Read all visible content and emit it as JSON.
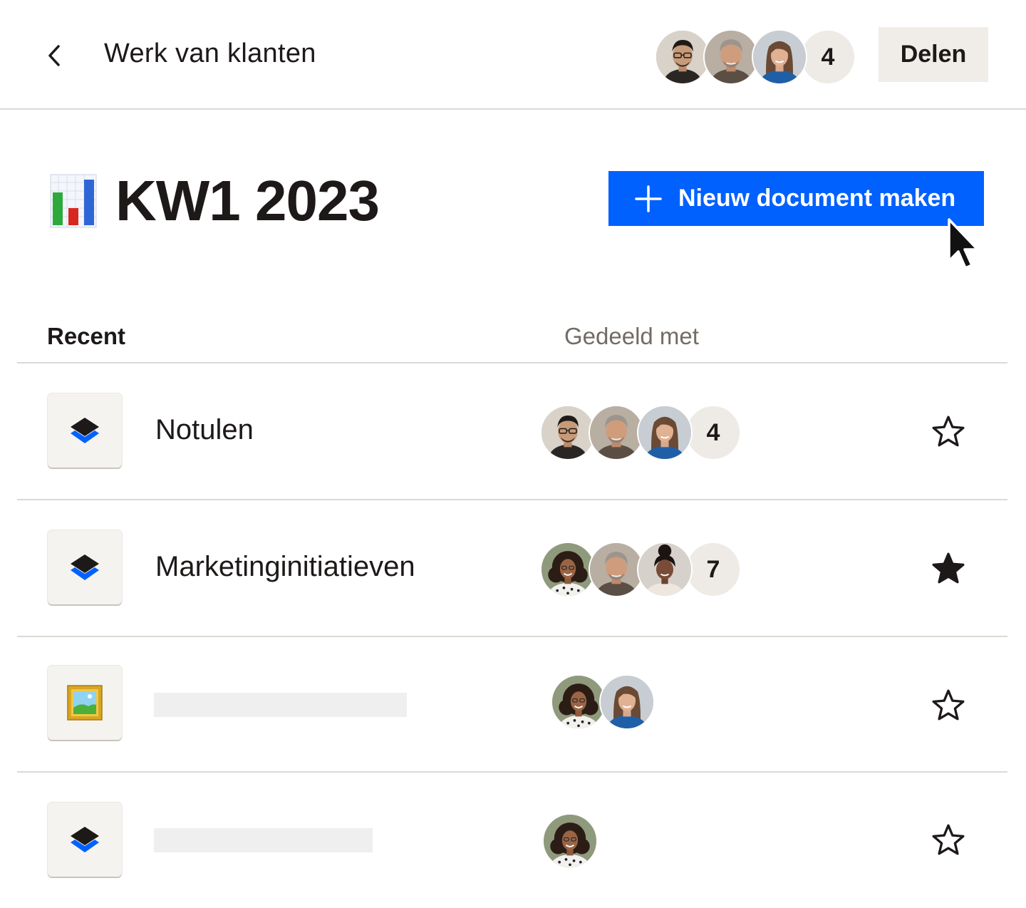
{
  "header": {
    "back_icon": "chevron-left-icon",
    "title": "Werk van klanten",
    "collaborators_extra": "4",
    "share_label": "Delen"
  },
  "folder": {
    "emoji": "bar-chart-emoji",
    "title": "KW1 2023",
    "new_doc_label": "Nieuw document maken",
    "new_doc_icon": "plus-icon"
  },
  "table": {
    "col_recent": "Recent",
    "col_shared": "Gedeeld met",
    "rows": [
      {
        "name": "Notulen",
        "icon": "paper-doc-icon",
        "shared_extra": "4",
        "starred": false
      },
      {
        "name": "Marketinginitiatieven",
        "icon": "paper-doc-icon",
        "shared_extra": "7",
        "starred": true
      },
      {
        "name": "",
        "icon": "framed-picture-icon",
        "shared_extra": "",
        "starred": false
      },
      {
        "name": "",
        "icon": "paper-doc-icon",
        "shared_extra": "",
        "starred": false
      }
    ]
  },
  "colors": {
    "accent_blue": "#0061fe",
    "text": "#1e1919",
    "muted_text": "#736c64",
    "divider": "#dcd9d5",
    "share_bg": "#f0ede8"
  }
}
